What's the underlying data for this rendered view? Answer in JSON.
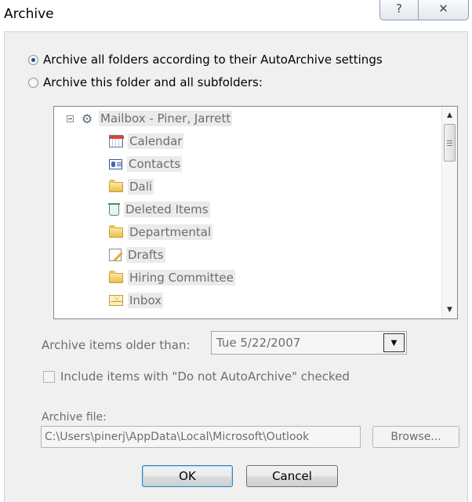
{
  "window": {
    "title": "Archive",
    "help_icon": "?",
    "close_icon": "✕"
  },
  "options": {
    "archive_all_label": "Archive all folders according to their AutoArchive settings",
    "archive_all_selected": true,
    "archive_folder_label": "Archive this folder and all subfolders:",
    "archive_folder_selected": false
  },
  "tree": {
    "root": {
      "label": "Mailbox - Piner, Jarrett",
      "icon": "mailbox-icon",
      "expanded": true
    },
    "items": [
      {
        "label": "Calendar",
        "icon": "calendar-icon"
      },
      {
        "label": "Contacts",
        "icon": "contacts-icon"
      },
      {
        "label": "Dali",
        "icon": "folder-icon"
      },
      {
        "label": "Deleted Items",
        "icon": "deleted-items-icon"
      },
      {
        "label": "Departmental",
        "icon": "folder-icon"
      },
      {
        "label": "Drafts",
        "icon": "drafts-icon"
      },
      {
        "label": "Hiring Committee",
        "icon": "folder-icon"
      },
      {
        "label": "Inbox",
        "icon": "inbox-icon"
      }
    ]
  },
  "older_than": {
    "label": "Archive items older than:",
    "value": "Tue 5/22/2007"
  },
  "include_do_not": {
    "label": "Include items with \"Do not AutoArchive\" checked",
    "checked": false
  },
  "archive_file": {
    "label": "Archive file:",
    "value": "C:\\Users\\pinerj\\AppData\\Local\\Microsoft\\Outlook",
    "browse_label": "Browse..."
  },
  "buttons": {
    "ok_label": "OK",
    "cancel_label": "Cancel"
  },
  "colors": {
    "dialog_bg": "#f0f0f0",
    "disabled_text": "#6d6d6d",
    "radio_selected": "#1f4f95",
    "default_button_border": "#3c7fb1"
  }
}
